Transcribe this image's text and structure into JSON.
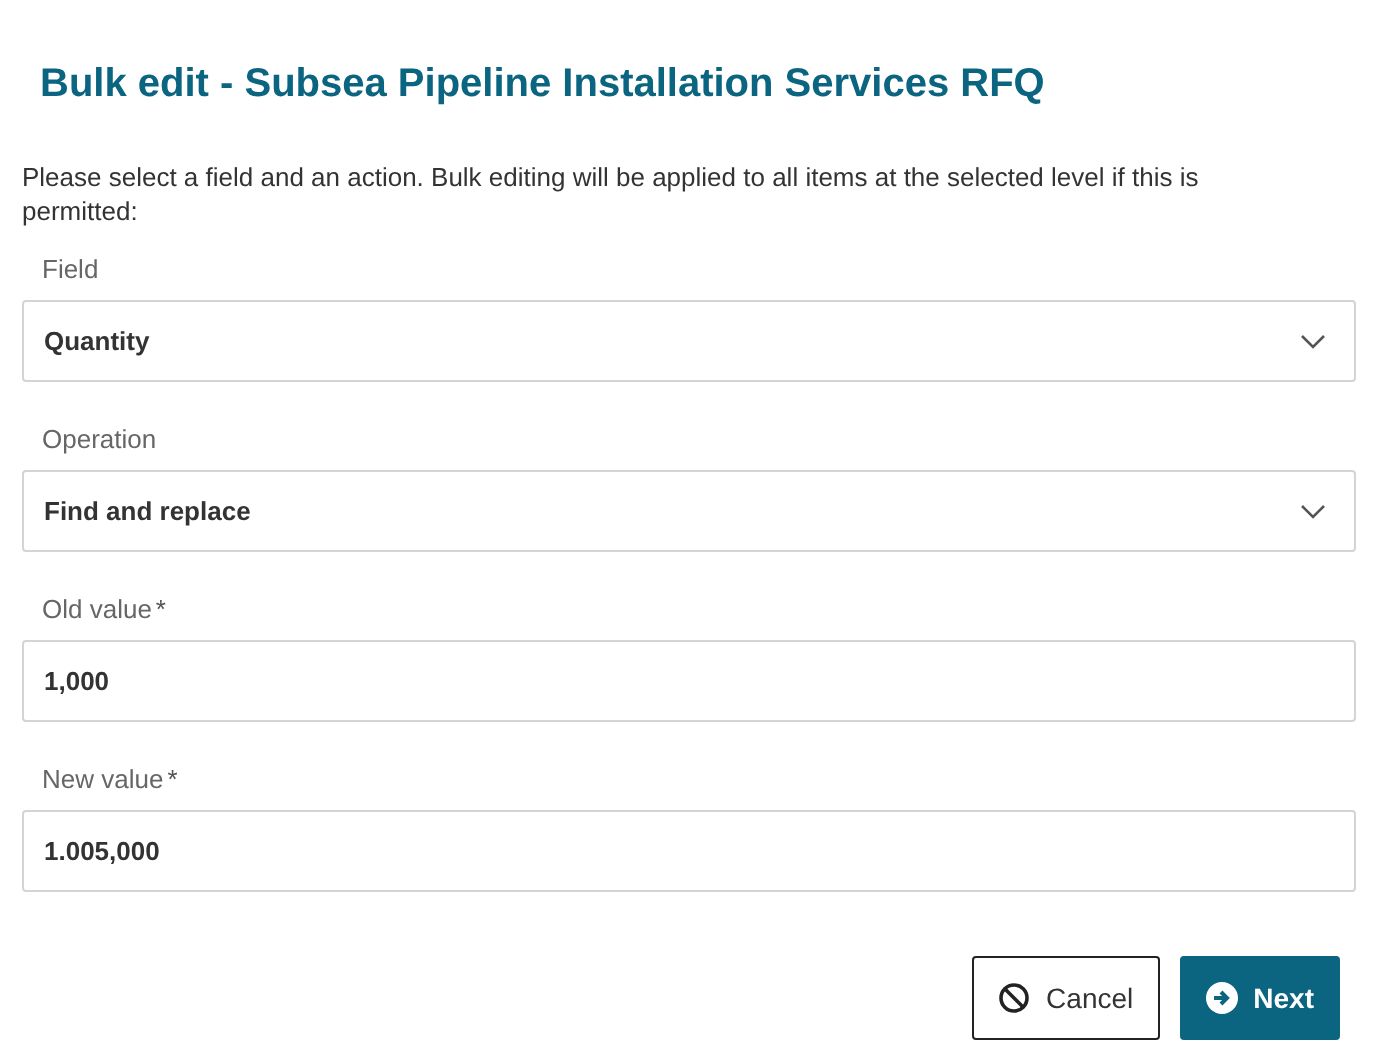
{
  "title": "Bulk edit - Subsea Pipeline Installation Services RFQ",
  "description": "Please select a field and an action. Bulk editing will be applied to all items at the selected level if this is permitted:",
  "fields": [
    {
      "kind": "select",
      "label": "Field",
      "required": false,
      "value": "Quantity"
    },
    {
      "kind": "select",
      "label": "Operation",
      "required": false,
      "value": "Find and replace"
    },
    {
      "kind": "text",
      "label": "Old value",
      "required": true,
      "value": "1,000"
    },
    {
      "kind": "text",
      "label": "New value",
      "required": true,
      "value": "1.005,000"
    }
  ],
  "required_mark": "*",
  "buttons": [
    {
      "kind": "cancel",
      "label": "Cancel"
    },
    {
      "kind": "next",
      "label": "Next"
    }
  ]
}
